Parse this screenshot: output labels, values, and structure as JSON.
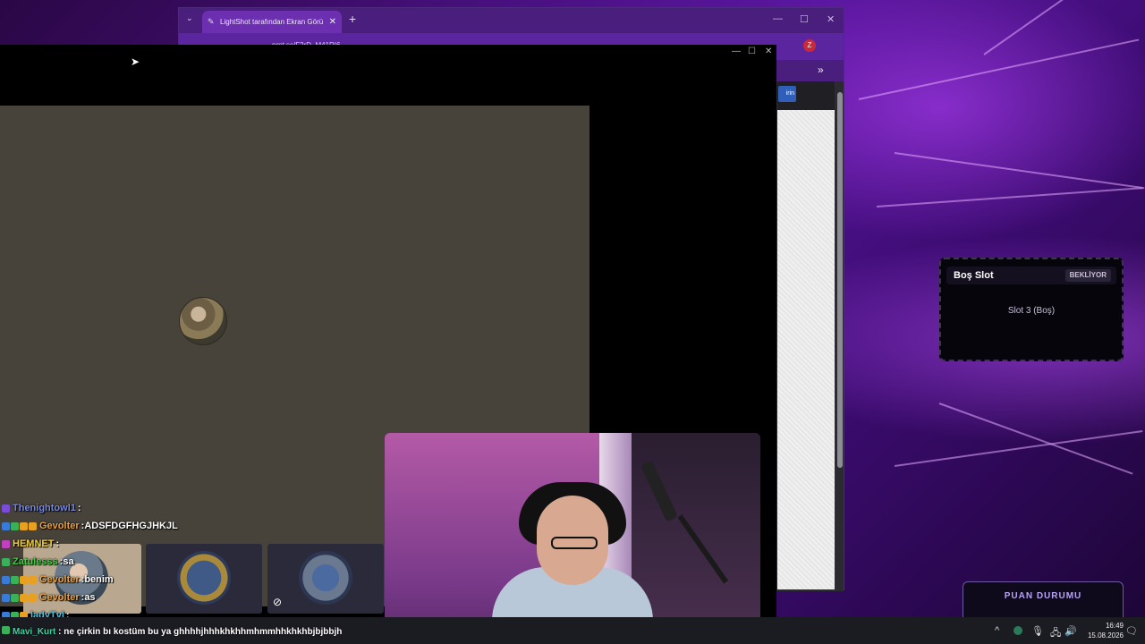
{
  "browser": {
    "tab_title": "LightShot tarafından Ekran Görü",
    "tab_close": "✕",
    "new_tab": "+",
    "tab_list": "⌄",
    "minimize": "—",
    "maximize": "☐",
    "close": "✕",
    "url": "prnt.sc/F2rD_M41RI6",
    "profile_letter": "Z",
    "bookmarks_overflow": "»",
    "page_button_partial": "irin"
  },
  "capture_window": {
    "minimize": "—",
    "maximize": "☐",
    "close": "✕"
  },
  "slot_widget": {
    "title": "Boş Slot",
    "status": "BEKLİYOR",
    "body": "Slot 3 (Boş)"
  },
  "points_widget": {
    "title": "PUAN DURUMU"
  },
  "chat": {
    "lines": [
      {
        "user": "Thenightowl1",
        "color": "#7a8ad8",
        "sep": " : ",
        "msg": ""
      },
      {
        "user": "Gevolter",
        "color": "#e8a040",
        "sep": " : ",
        "msg": "ADSFDGFHGJHKJL"
      },
      {
        "user": "HEMNET",
        "color": "#f0d040",
        "sep": " : ",
        "msg": ""
      },
      {
        "user": "Zatulesss",
        "color": "#40d040",
        "sep": " : ",
        "msg": "sa"
      },
      {
        "user": "Gevolter",
        "color": "#e8a040",
        "sep": " : ",
        "msg": "benim"
      },
      {
        "user": "Gevolter",
        "color": "#e8a040",
        "sep": " : ",
        "msg": "as"
      },
      {
        "user": "ladyTvl",
        "color": "#50c0e0",
        "sep": " : ",
        "msg": ""
      }
    ],
    "bottom_line": {
      "user": "Mavi_Kurt",
      "color": "#40d0a0",
      "sep": " : ",
      "msg": "ne çirkin bı kostüm bu ya ghhhhjhhhkhkhhmhmmhhkhkhbjbjbbjh"
    }
  },
  "taskbar": {
    "time": "16:49",
    "date": "15.08.2026",
    "tray_up": "^",
    "mic": "🎙",
    "speaker": "🔊",
    "network": "🖧",
    "notification": "🗨"
  },
  "colors": {
    "wallpaper_accent": "#8a2be2",
    "capture_canvas": "#47423a",
    "badge_blue": "#3a7ad8",
    "badge_green": "#3ab05a",
    "badge_orange": "#e8a020"
  }
}
